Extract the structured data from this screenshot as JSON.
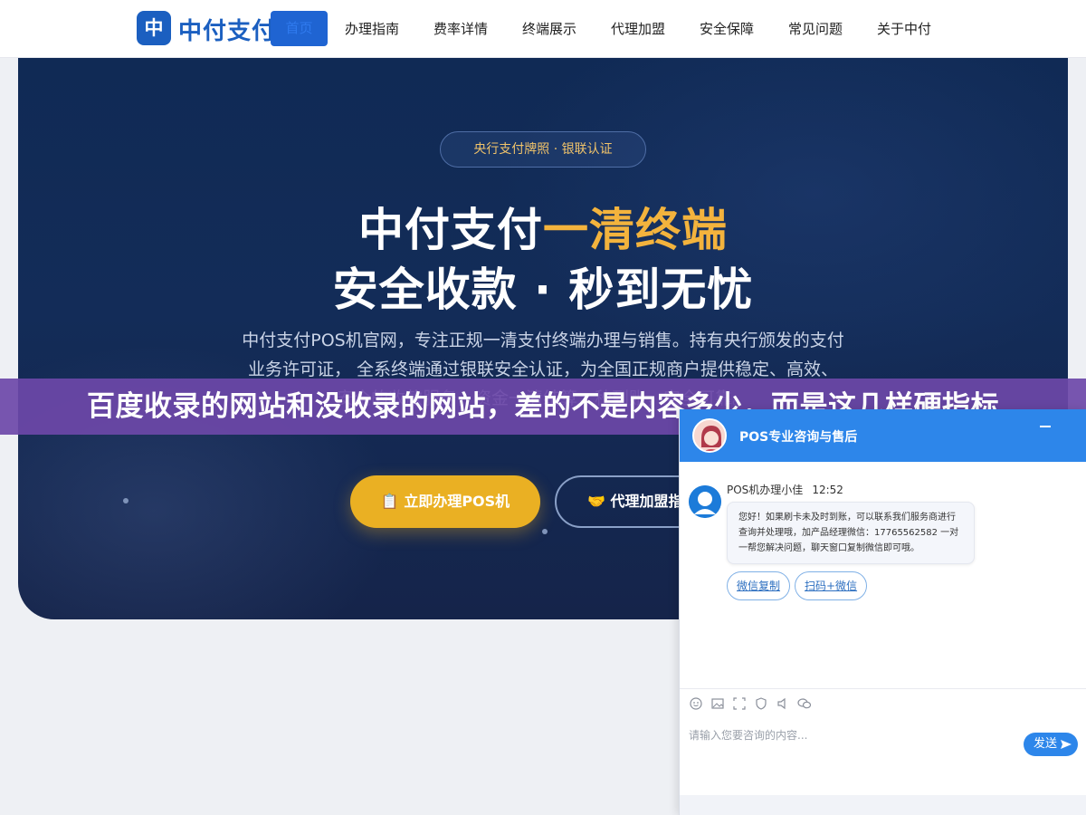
{
  "nav": {
    "logo_mark": "中",
    "logo_text": "中付支付",
    "active_item": "首页",
    "items": [
      "办理指南",
      "费率详情",
      "终端展示",
      "代理加盟",
      "安全保障",
      "常见问题",
      "关于中付"
    ]
  },
  "hero": {
    "badge": "央行支付牌照 · 银联认证",
    "title_line1_prefix": "中付支付",
    "title_line1_highlight": "一清终端",
    "title_line2": "安全收款 · 秒到无忧",
    "description": "中付支付POS机官网，专注正规一清支付终端办理与销售。持有央行颁发的支付业务许可证， 全系终端通过银联安全认证，为全国正规商户提供稳定、高效、安全的收款服务，资金一清结算，秒到账，安全可靠。",
    "primary_button": "立即办理POS机",
    "primary_icon": "📋",
    "secondary_button": "代理加盟指南",
    "secondary_icon": "🤝"
  },
  "banner": {
    "text": "百度收录的网站和没收录的网站，差的不是内容多少，而是这几样硬指标"
  },
  "chat": {
    "header_title": "POS专业咨询与售后",
    "agent_name": "POS机办理小佳",
    "message_time": "12:52",
    "message_text": "您好！如果刷卡未及时到账，可以联系我们服务商进行查询并处理哦，加产品经理微信：17765562582 一对一帮您解决问题，聊天窗口复制微信即可哦。",
    "quick_replies": [
      "微信复制",
      "扫码+微信"
    ],
    "input_placeholder": "请输入您要咨询的内容...",
    "send_label": "发送",
    "toolbar_icons": [
      "emoji-icon",
      "image-icon",
      "screenshot-icon",
      "evaluate-icon",
      "audio-icon",
      "wechat-icon"
    ],
    "colors": {
      "header": "#2d86ea",
      "accent": "#eab023",
      "banner": "#6c48a8"
    }
  }
}
